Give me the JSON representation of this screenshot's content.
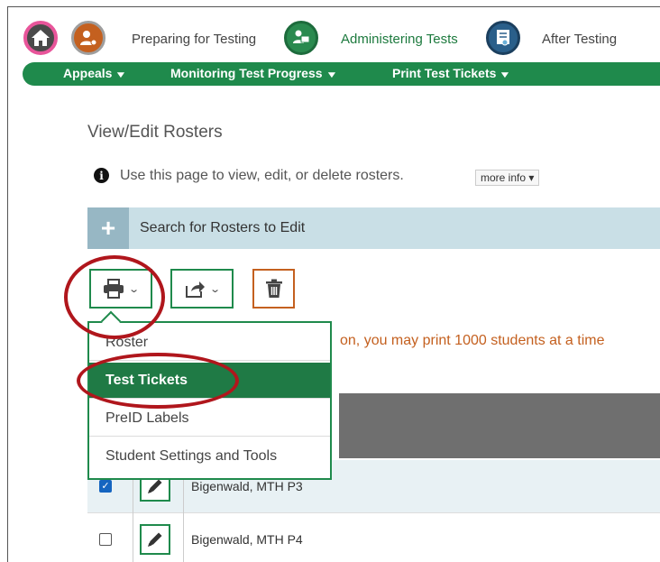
{
  "topnav": {
    "preparing": "Preparing for Testing",
    "administering": "Administering Tests",
    "after": "After Testing"
  },
  "subnav": {
    "appeals": "Appeals",
    "monitoring": "Monitoring Test Progress",
    "print_tickets": "Print Test Tickets"
  },
  "page": {
    "title": "View/Edit Rosters",
    "info": "Use this page to view, edit, or delete rosters.",
    "more_info": "more info",
    "search": "Search for Rosters to Edit",
    "warning": "on, you may print 1000 students at a time"
  },
  "dropdown": {
    "items": [
      "Roster",
      "Test Tickets",
      "PreID Labels",
      "Student Settings and Tools"
    ],
    "selected": "Test Tickets"
  },
  "rows": [
    {
      "name": "Bigenwald, MTH P3",
      "checked": true
    },
    {
      "name": "Bigenwald, MTH P4",
      "checked": false
    }
  ],
  "colors": {
    "green": "#1f8a4c",
    "orange": "#c4601f",
    "annotation_red": "#b0161c"
  }
}
